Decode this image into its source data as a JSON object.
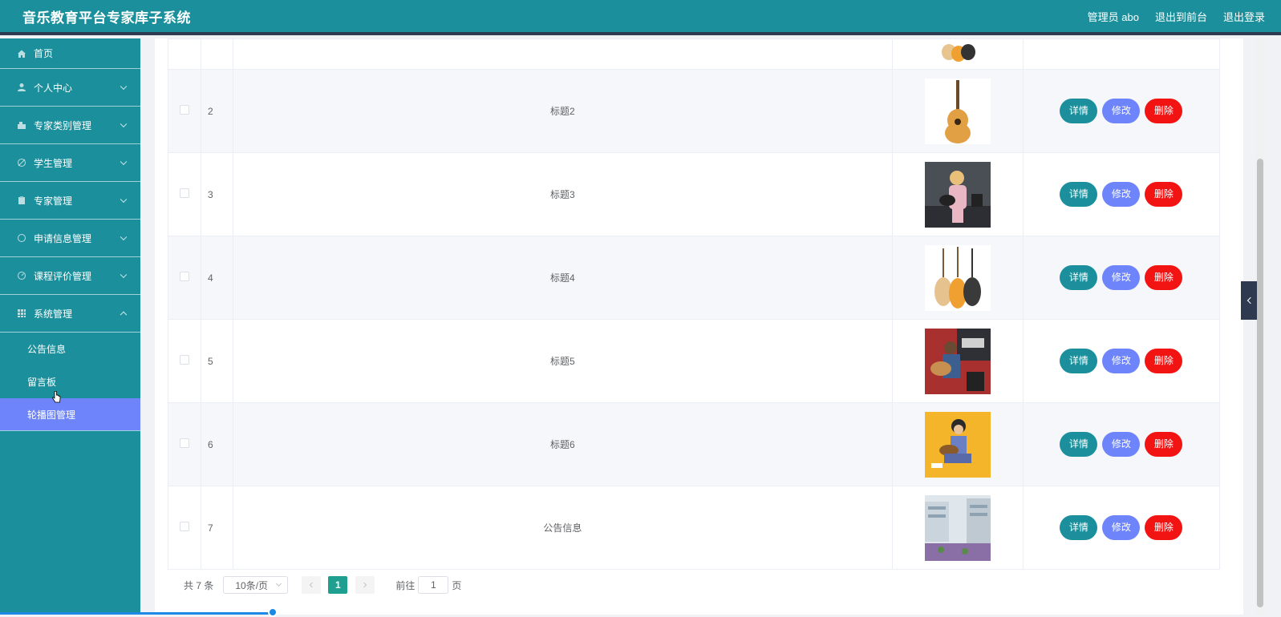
{
  "header": {
    "title": "音乐教育平台专家库子系统",
    "user": "管理员 abo",
    "to_front": "退出到前台",
    "logout": "退出登录"
  },
  "sidebar": {
    "items": [
      {
        "label": "首页",
        "icon": "home-icon"
      },
      {
        "label": "个人中心",
        "icon": "user-icon"
      },
      {
        "label": "专家类别管理",
        "icon": "category-icon"
      },
      {
        "label": "学生管理",
        "icon": "student-icon"
      },
      {
        "label": "专家管理",
        "icon": "expert-icon"
      },
      {
        "label": "申请信息管理",
        "icon": "apply-icon"
      },
      {
        "label": "课程评价管理",
        "icon": "rating-icon"
      },
      {
        "label": "系统管理",
        "icon": "grid-icon"
      }
    ],
    "sub_items": [
      "公告信息",
      "留言板",
      "轮播图管理"
    ],
    "active_sub": "轮播图管理"
  },
  "table": {
    "rows": [
      {
        "index": "2",
        "title": "标题2",
        "image": "acoustic guitar"
      },
      {
        "index": "3",
        "title": "标题3",
        "image": "woman playing guitar"
      },
      {
        "index": "4",
        "title": "标题4",
        "image": "three guitars"
      },
      {
        "index": "5",
        "title": "标题5",
        "image": "man playing guitar"
      },
      {
        "index": "6",
        "title": "标题6",
        "image": "girl with guitar on yellow"
      },
      {
        "index": "7",
        "title": "公告信息",
        "image": "campus building"
      }
    ],
    "actions": {
      "detail": "详情",
      "edit": "修改",
      "delete": "删除"
    }
  },
  "pagination": {
    "total": "共 7 条",
    "page_size": "10条/页",
    "current_page": "1",
    "goto_label": "前往",
    "goto_value": "1",
    "page_suffix": "页"
  },
  "colors": {
    "primary": "#1b909c",
    "edit": "#6d84fa",
    "delete": "#f21313",
    "header_border": "#2d3a4f"
  }
}
